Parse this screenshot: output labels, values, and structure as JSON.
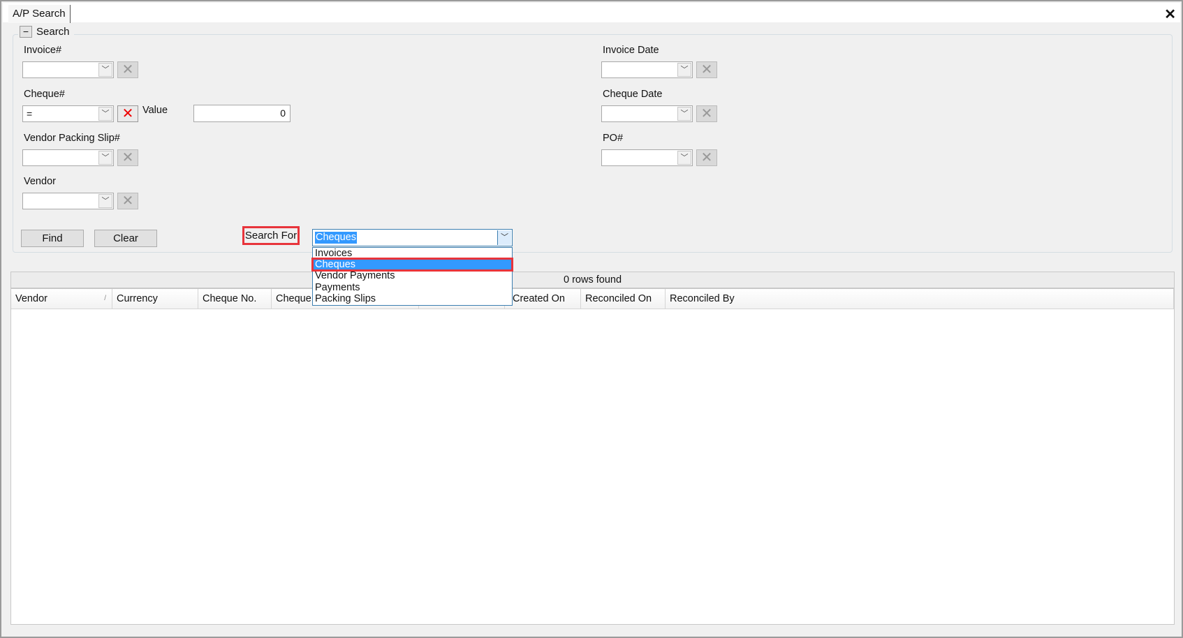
{
  "window": {
    "tab_title": "A/P Search",
    "close_icon": "close-icon"
  },
  "search_group": {
    "title": "Search",
    "collapse_icon": "minus-icon"
  },
  "fields": {
    "invoice": {
      "label": "Invoice#",
      "value": ""
    },
    "cheque": {
      "label": "Cheque#",
      "operator": "=",
      "value_label": "Value",
      "value": "0"
    },
    "packing_slip": {
      "label": "Vendor Packing Slip#",
      "value": ""
    },
    "vendor": {
      "label": "Vendor",
      "value": ""
    },
    "invoice_date": {
      "label": "Invoice Date",
      "value": ""
    },
    "cheque_date": {
      "label": "Cheque Date",
      "value": ""
    },
    "po": {
      "label": "PO#",
      "value": ""
    }
  },
  "buttons": {
    "find": "Find",
    "clear": "Clear"
  },
  "search_for": {
    "label": "Search For",
    "selected": "Cheques",
    "options": [
      "Invoices",
      "Cheques",
      "Vendor Payments",
      "Payments",
      "Packing Slips"
    ]
  },
  "status": "0 rows found",
  "grid": {
    "columns": [
      "Vendor",
      "Currency",
      "Cheque No.",
      "Cheque",
      "",
      "",
      "Created On",
      "Reconciled On",
      "Reconciled By"
    ],
    "sort_indicator": "/"
  },
  "colors": {
    "highlight_red": "#e8343b",
    "selection_blue": "#3399ff"
  }
}
